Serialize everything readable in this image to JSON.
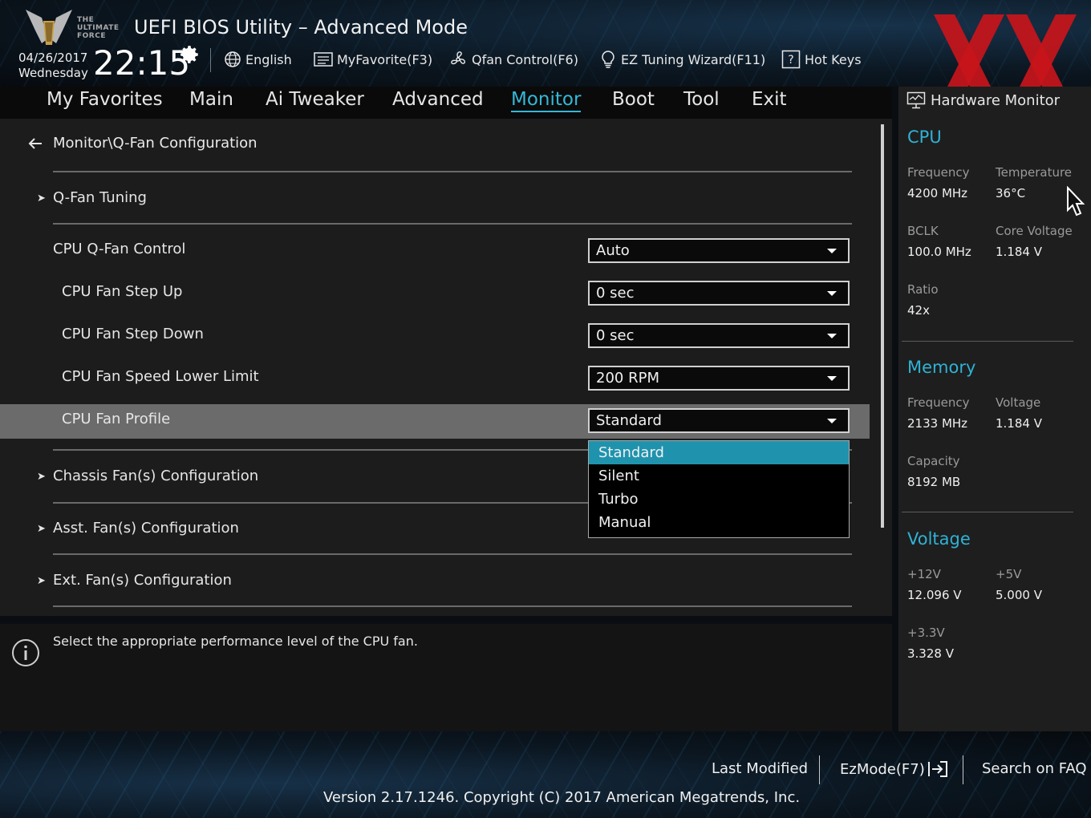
{
  "header": {
    "logo_text": [
      "THE",
      "ULTIMATE",
      "FORCE"
    ],
    "title": "UEFI BIOS Utility – Advanced Mode",
    "date": "04/26/2017",
    "weekday": "Wednesday",
    "time": "22:15",
    "tools": {
      "language": "English",
      "my_favorite": "MyFavorite(F3)",
      "qfan": "Qfan Control(F6)",
      "ez_tuning": "EZ Tuning Wizard(F11)",
      "hot_keys": "Hot Keys"
    }
  },
  "nav": {
    "tabs": [
      "My Favorites",
      "Main",
      "Ai Tweaker",
      "Advanced",
      "Monitor",
      "Boot",
      "Tool",
      "Exit"
    ],
    "active": "Monitor"
  },
  "main": {
    "breadcrumb": "Monitor\\Q-Fan Configuration",
    "qfan_tuning": "Q-Fan Tuning",
    "settings": [
      {
        "label": "CPU Q-Fan Control",
        "value": "Auto"
      },
      {
        "label": "CPU Fan Step Up",
        "value": "0 sec"
      },
      {
        "label": "CPU Fan Step Down",
        "value": "0 sec"
      },
      {
        "label": "CPU Fan Speed Lower Limit",
        "value": "200 RPM"
      },
      {
        "label": "CPU Fan Profile",
        "value": "Standard"
      }
    ],
    "dropdown_options": [
      "Standard",
      "Silent",
      "Turbo",
      "Manual"
    ],
    "dropdown_selected": "Standard",
    "submenus": [
      "Chassis Fan(s) Configuration",
      "Asst. Fan(s) Configuration",
      "Ext. Fan(s) Configuration"
    ]
  },
  "info": {
    "text": "Select the appropriate performance level of the CPU fan."
  },
  "hardware_monitor": {
    "title": "Hardware Monitor",
    "cpu": {
      "heading": "CPU",
      "frequency_label": "Frequency",
      "frequency": "4200 MHz",
      "temperature_label": "Temperature",
      "temperature": "36°C",
      "bclk_label": "BCLK",
      "bclk": "100.0 MHz",
      "core_voltage_label": "Core Voltage",
      "core_voltage": "1.184 V",
      "ratio_label": "Ratio",
      "ratio": "42x"
    },
    "memory": {
      "heading": "Memory",
      "frequency_label": "Frequency",
      "frequency": "2133 MHz",
      "voltage_label": "Voltage",
      "voltage": "1.184 V",
      "capacity_label": "Capacity",
      "capacity": "8192 MB"
    },
    "voltage": {
      "heading": "Voltage",
      "v12_label": "+12V",
      "v12": "12.096 V",
      "v5_label": "+5V",
      "v5": "5.000 V",
      "v33_label": "+3.3V",
      "v33": "3.328 V"
    }
  },
  "footer": {
    "last_modified": "Last Modified",
    "ezmode": "EzMode(F7)",
    "search_faq": "Search on FAQ",
    "version": "Version 2.17.1246. Copyright (C) 2017 American Megatrends, Inc."
  },
  "colors": {
    "accent": "#34b8d8",
    "dropdown_selected_bg": "#1f93ad",
    "watermark": "#c8151b"
  }
}
